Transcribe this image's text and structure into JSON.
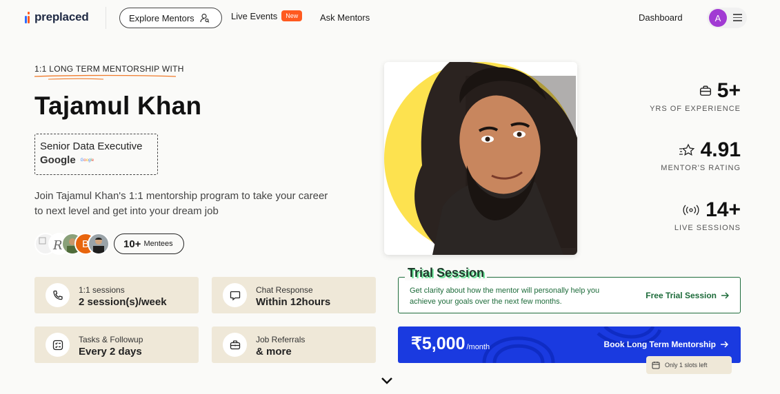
{
  "nav": {
    "logo_text": "preplaced",
    "explore_label": "Explore Mentors",
    "live_events_label": "Live Events",
    "live_events_badge": "New",
    "ask_mentors_label": "Ask Mentors",
    "dashboard_label": "Dashboard",
    "avatar_initial": "A"
  },
  "hero": {
    "eyebrow": "1:1 LONG TERM MENTORSHIP WITH",
    "name": "Tajamul Khan",
    "role": "Senior Data Executive",
    "company": "Google",
    "blurb": "Join Tajamul Khan's 1:1 mentorship program to take your career to next level and get into your dream job",
    "mentee_count": "10+",
    "mentee_label": "Mentees",
    "mentee_avatar_initial": "B"
  },
  "stat_cards": [
    {
      "icon": "phone-icon",
      "label": "1:1 sessions",
      "value": "2 session(s)/week"
    },
    {
      "icon": "chat-icon",
      "label": "Chat Response",
      "value": "Within 12hours"
    },
    {
      "icon": "tasks-icon",
      "label": "Tasks & Followup",
      "value": "Every 2 days"
    },
    {
      "icon": "briefcase-icon",
      "label": "Job Referrals",
      "value": "& more"
    }
  ],
  "right_stats": [
    {
      "icon": "briefcase-icon",
      "value": "5+",
      "caption": "YRS OF EXPERIENCE"
    },
    {
      "icon": "star-icon",
      "value": "4.91",
      "caption": "MENTOR'S RATING"
    },
    {
      "icon": "broadcast-icon",
      "value": "14+",
      "caption": "LIVE SESSIONS"
    }
  ],
  "trial": {
    "tag": "Trial Session",
    "description": "Get clarity about how the mentor will personally help you achieve your goals over the next few months.",
    "cta": "Free Trial Session"
  },
  "booking": {
    "price": "₹5,000",
    "period": "/month",
    "cta": "Book Long Term Mentorship",
    "slots_text": "Only 1 slots left"
  },
  "colors": {
    "accent_blue": "#1a3ae0",
    "trial_green": "#1d6b3a",
    "card_beige": "#efe8d8",
    "photo_yellow": "#fde24f",
    "avatar_purple": "#a13ad3",
    "badge_orange": "#ff5a1f"
  }
}
